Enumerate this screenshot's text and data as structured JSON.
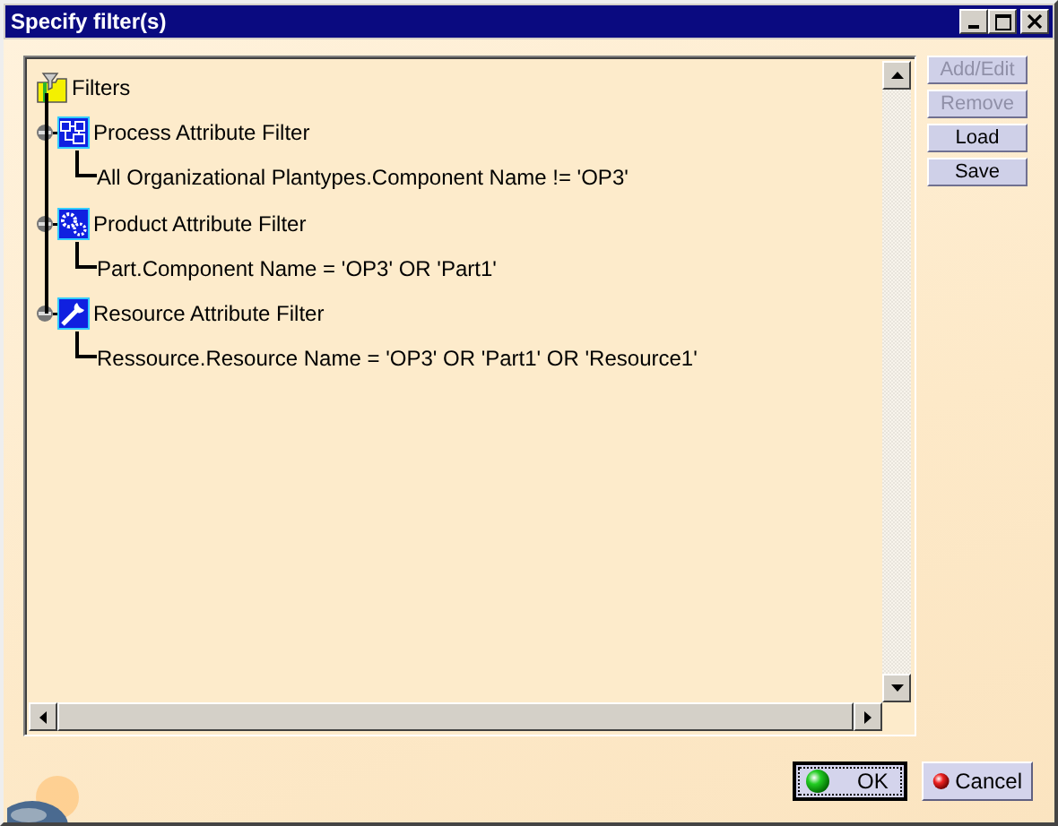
{
  "window": {
    "title": "Specify filter(s)"
  },
  "tree": {
    "label": "Filters",
    "children": [
      {
        "kind": "process",
        "label": "Process Attribute Filter",
        "expanded": true,
        "children": [
          {
            "label": "All Organizational Plantypes.Component Name != 'OP3'"
          }
        ]
      },
      {
        "kind": "product",
        "label": "Product Attribute Filter",
        "expanded": true,
        "children": [
          {
            "label": "Part.Component Name = 'OP3' OR 'Part1'"
          }
        ]
      },
      {
        "kind": "resource",
        "label": "Resource Attribute Filter",
        "expanded": true,
        "children": [
          {
            "label": "Ressource.Resource Name = 'OP3' OR 'Part1' OR 'Resource1'"
          }
        ]
      }
    ]
  },
  "side_buttons": [
    {
      "label": "Add/Edit",
      "disabled": true
    },
    {
      "label": "Remove",
      "disabled": true
    },
    {
      "label": "Load",
      "disabled": false
    },
    {
      "label": "Save",
      "disabled": false
    }
  ],
  "buttons": [
    {
      "kind": "ok",
      "label": "OK",
      "default": true
    },
    {
      "kind": "cancel",
      "label": "Cancel",
      "default": false
    }
  ]
}
